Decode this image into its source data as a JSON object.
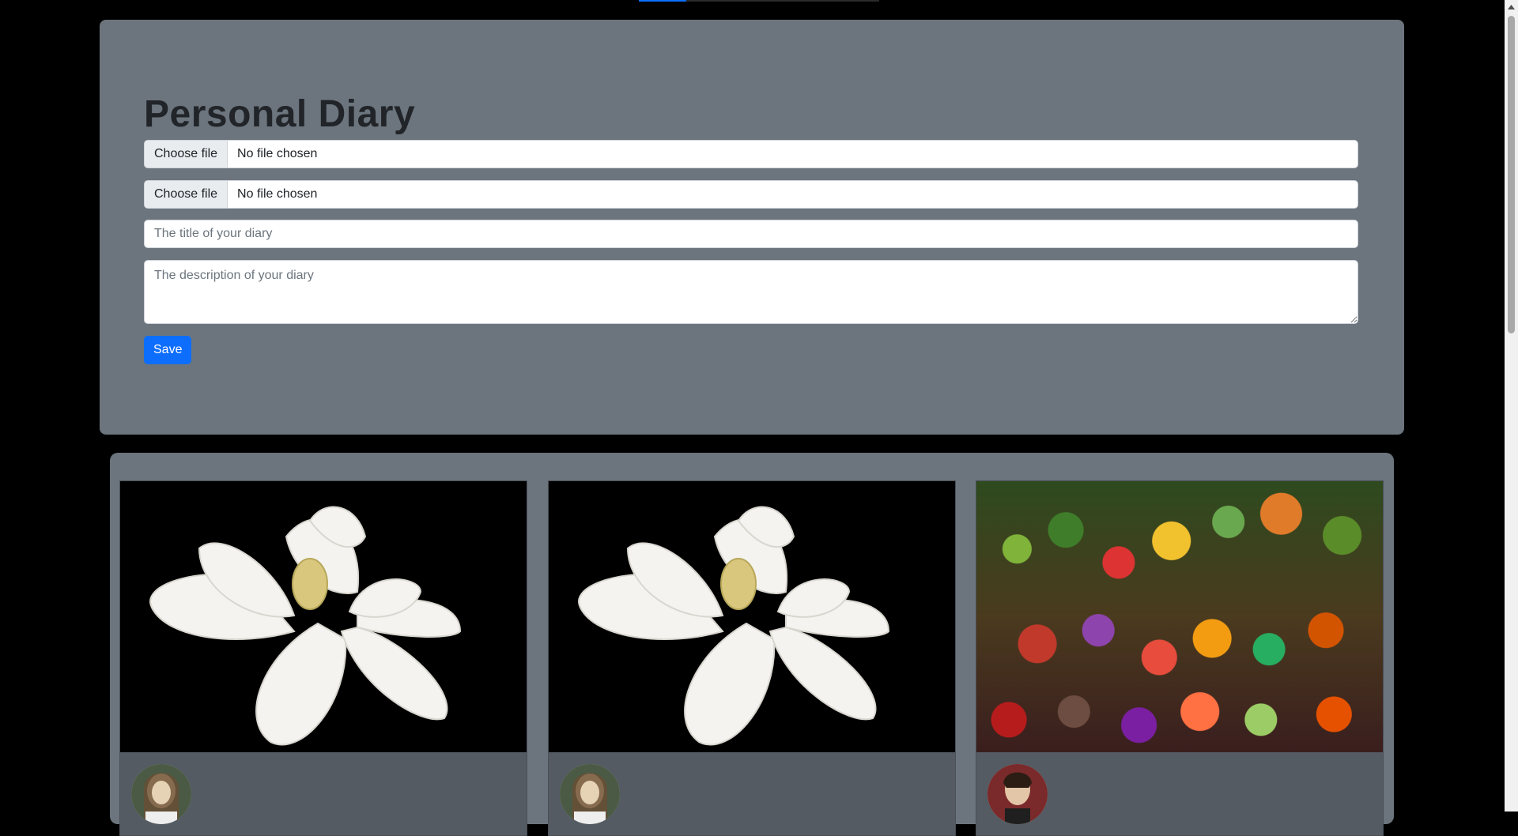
{
  "hero": {
    "title": "Personal Diary",
    "file_inputs": [
      {
        "button_label": "Choose file",
        "status": "No file chosen"
      },
      {
        "button_label": "Choose file",
        "status": "No file chosen"
      }
    ],
    "title_placeholder": "The title of your diary",
    "description_placeholder": "The description of your diary",
    "save_label": "Save"
  },
  "gallery": {
    "cards": [
      {
        "image": "magnolia-flower",
        "avatar": "user-avatar"
      },
      {
        "image": "magnolia-flower",
        "avatar": "user-avatar"
      },
      {
        "image": "vegetable-market",
        "avatar": "user-avatar"
      }
    ]
  },
  "colors": {
    "panel": "#6c757d",
    "primary": "#0d6efd",
    "heading": "#212529"
  }
}
